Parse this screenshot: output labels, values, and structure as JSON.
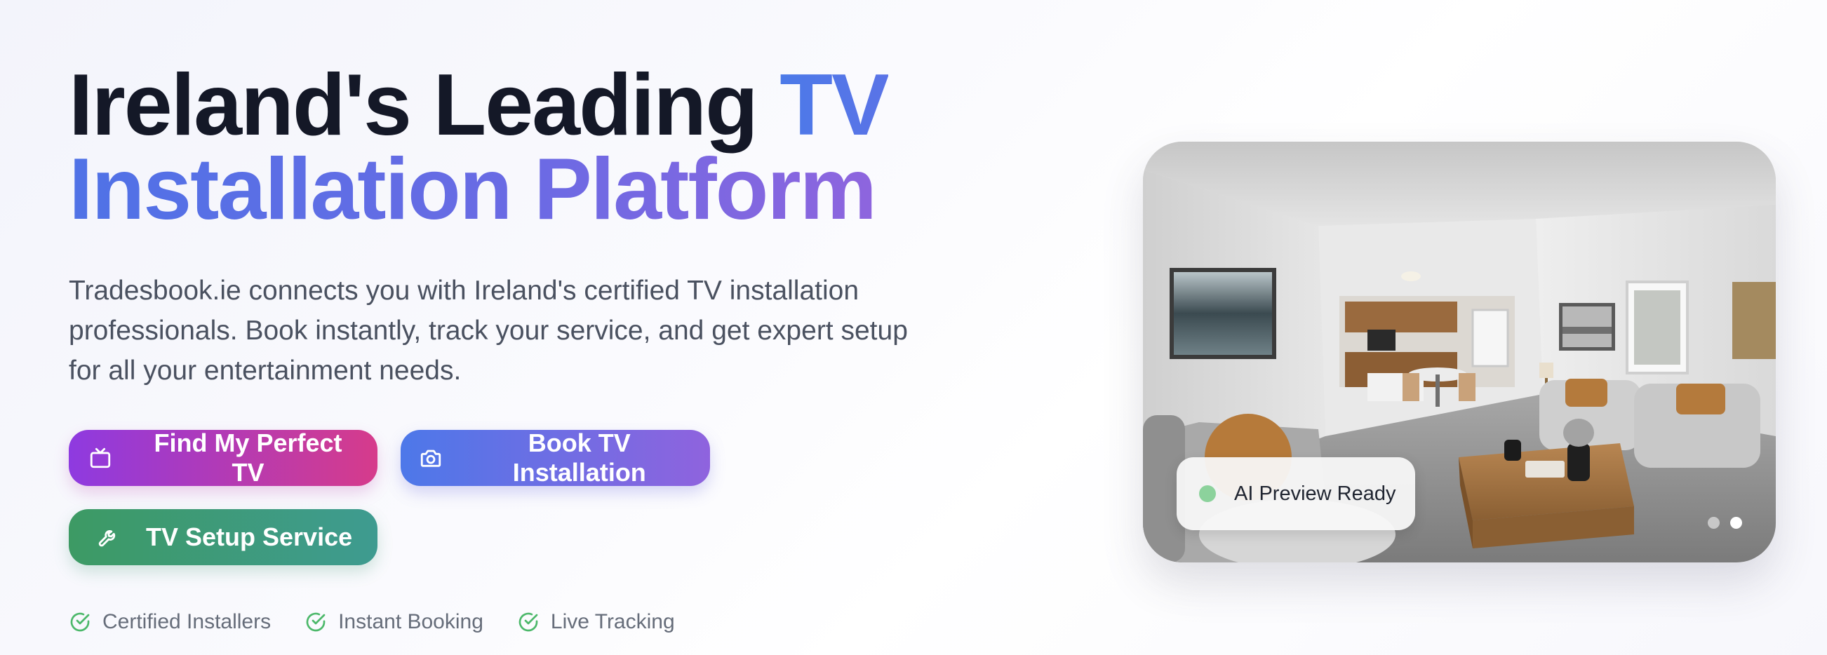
{
  "hero": {
    "headline_part1": "Ireland's Leading ",
    "headline_part2": "TV",
    "headline_line2": "Installation Platform",
    "description": "Tradesbook.ie connects you with Ireland's certified TV installation professionals. Book instantly, track your service, and get expert setup for all your entertainment needs."
  },
  "buttons": {
    "find_tv": {
      "label": "Find My Perfect TV",
      "icon": "tv-icon"
    },
    "book_install": {
      "label": "Book TV Installation",
      "icon": "camera-icon"
    },
    "setup_service": {
      "label": "TV Setup Service",
      "icon": "wrench-icon"
    }
  },
  "features": [
    {
      "label": "Certified Installers",
      "icon": "check-circle-icon"
    },
    {
      "label": "Instant Booking",
      "icon": "check-circle-icon"
    },
    {
      "label": "Live Tracking",
      "icon": "check-circle-icon"
    }
  ],
  "preview_card": {
    "badge_label": "AI Preview Ready",
    "status_color": "#8cd29c",
    "carousel": {
      "slides": 2,
      "active": 2
    }
  },
  "colors": {
    "headline_dark": "#141827",
    "gradient_blue": "#4f72e6",
    "gradient_purple": "#9a63dc",
    "find_tv_button": [
      "#8e3ae0",
      "#d63b8b"
    ],
    "book_button": [
      "#4d78e9",
      "#8f63de"
    ],
    "setup_button": [
      "#3d9a64",
      "#3e9b90"
    ],
    "feature_check": "#4cb86a"
  }
}
